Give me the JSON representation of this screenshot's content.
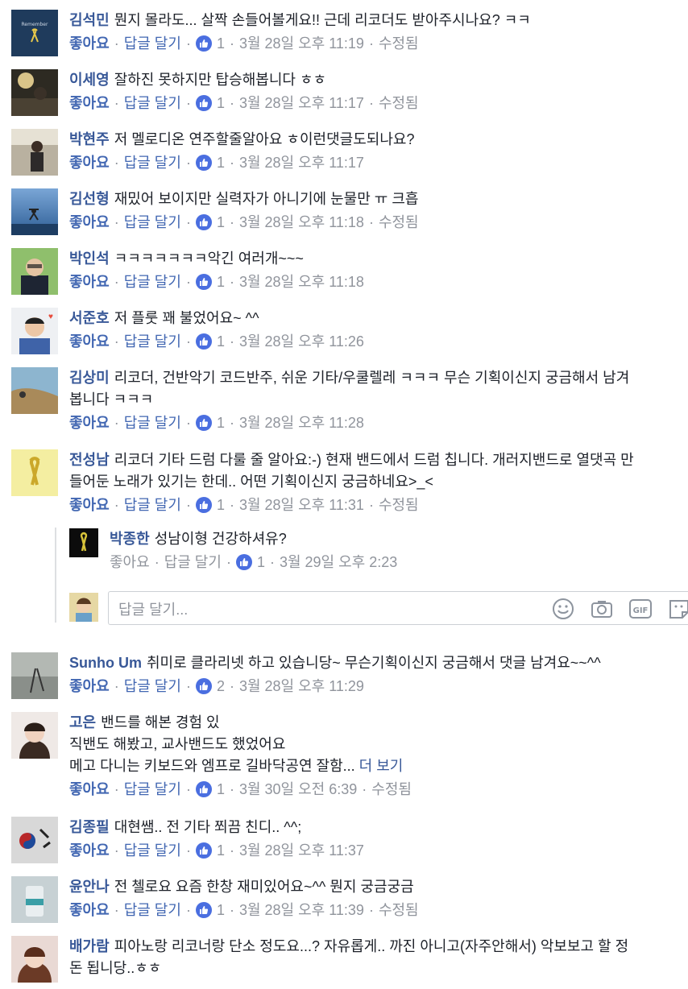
{
  "comments": [
    {
      "name": "김석민",
      "text": "뭔지 몰라도... 살짝 손들어볼게요!! 근데 리코더도 받아주시나요? ㅋㅋ",
      "like": "좋아요",
      "reply": "답글 달기",
      "reactions": "1",
      "time": "3월 28일 오후 11:19",
      "edited": "수정됨"
    },
    {
      "name": "이세영",
      "text": "잘하진 못하지만 탑승해봅니다 ㅎㅎ",
      "like": "좋아요",
      "reply": "답글 달기",
      "reactions": "1",
      "time": "3월 28일 오후 11:17",
      "edited": "수정됨"
    },
    {
      "name": "박현주",
      "text": "저 멜로디온 연주할줄알아요 ㅎ이런댓글도되나요?",
      "like": "좋아요",
      "reply": "답글 달기",
      "reactions": "1",
      "time": "3월 28일 오후 11:17",
      "edited": ""
    },
    {
      "name": "김선형",
      "text": "재밌어 보이지만 실력자가 아니기에 눈물만 ㅠ 크흡",
      "like": "좋아요",
      "reply": "답글 달기",
      "reactions": "1",
      "time": "3월 28일 오후 11:18",
      "edited": "수정됨"
    },
    {
      "name": "박인석",
      "text": "ㅋㅋㅋㅋㅋㅋㅋ악긴 여러개~~~",
      "like": "좋아요",
      "reply": "답글 달기",
      "reactions": "1",
      "time": "3월 28일 오후 11:18",
      "edited": ""
    },
    {
      "name": "서준호",
      "text": "저 플룻 꽤 불었어요~ ^^",
      "like": "좋아요",
      "reply": "답글 달기",
      "reactions": "1",
      "time": "3월 28일 오후 11:26",
      "edited": ""
    },
    {
      "name": "김상미",
      "text": "리코더, 건반악기 코드반주, 쉬운 기타/우쿨렐레 ㅋㅋㅋ 무슨 기획이신지 궁금해서 남겨",
      "text2": "봅니다 ㅋㅋㅋ",
      "like": "좋아요",
      "reply": "답글 달기",
      "reactions": "1",
      "time": "3월 28일 오후 11:28",
      "edited": ""
    },
    {
      "name": "전성남",
      "text": "리코더 기타 드럼 다룰 줄 알아요:-) 현재 밴드에서 드럼 칩니다. 개러지밴드로 열댓곡 만",
      "text2": "들어둔 노래가 있기는 한데.. 어떤 기획이신지 궁금하네요>_<",
      "like": "좋아요",
      "reply": "답글 달기",
      "reactions": "1",
      "time": "3월 28일 오후 11:31",
      "edited": "수정됨"
    },
    {
      "name": "Sunho Um",
      "text": "취미로 클라리넷 하고 있습니당~ 무슨기획이신지 궁금해서 댓글 남겨요~~^^",
      "like": "좋아요",
      "reply": "답글 달기",
      "reactions": "2",
      "time": "3월 28일 오후 11:29",
      "edited": ""
    },
    {
      "name": "고은",
      "text": "밴드를 해본 경험 있",
      "text2": "직밴도 해봤고, 교사밴드도 했었어요",
      "text3": "메고 다니는 키보드와 엠프로 길바닥공연 잘함...",
      "more": "더 보기",
      "like": "좋아요",
      "reply": "답글 달기",
      "reactions": "1",
      "time": "3월 30일 오전 6:39",
      "edited": "수정됨"
    },
    {
      "name": "김종필",
      "text": "대현쌤.. 전 기타 쬐끔 친디.. ^^;",
      "like": "좋아요",
      "reply": "답글 달기",
      "reactions": "1",
      "time": "3월 28일 오후 11:37",
      "edited": ""
    },
    {
      "name": "윤안나",
      "text": "전 첼로요 요즘 한창 재미있어요~^^ 뭔지 궁금궁금",
      "like": "좋아요",
      "reply": "답글 달기",
      "reactions": "1",
      "time": "3월 28일 오후 11:39",
      "edited": "수정됨"
    },
    {
      "name": "배가람",
      "text": "피아노랑 리코너랑 단소 정도요...? 자유롭게.. 까진 아니고(자주안해서) 악보보고 할 정",
      "text2": "돈 됩니당..ㅎㅎ"
    }
  ],
  "reply": {
    "name": "박종한",
    "text": "성남이형 건강하셔유?",
    "like": "좋아요",
    "reply": "답글 달기",
    "reactions": "1",
    "time": "3월 29일 오후 2:23"
  },
  "reply_box": {
    "placeholder": "답글 달기...",
    "icons": [
      "smiley-icon",
      "camera-icon",
      "gif-icon",
      "sticker-icon"
    ]
  },
  "colors": {
    "name": "#385898",
    "action": "#4267b2",
    "meta": "#90949c",
    "like_badge": "#4a6ee0"
  }
}
